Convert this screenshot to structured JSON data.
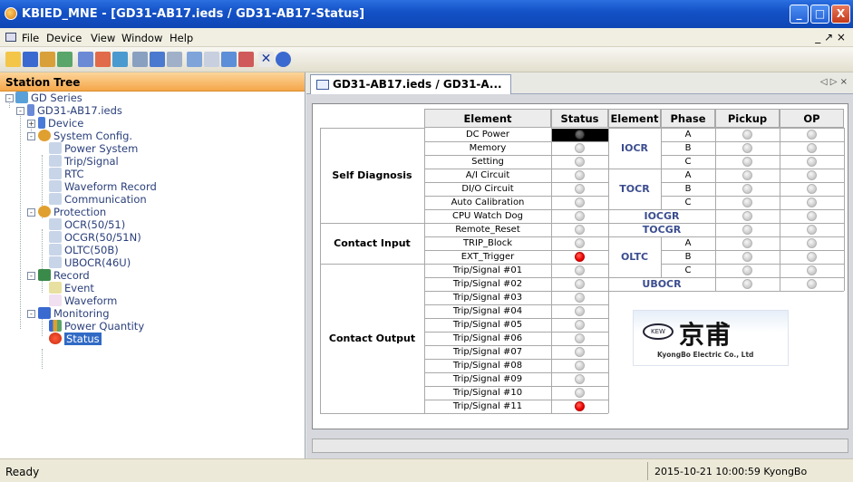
{
  "window": {
    "title": "KBIED_MNE - [GD31-AB17.ieds / GD31-AB17-Status]",
    "controls": {
      "minimize": "_",
      "maximize": "□",
      "close": "X"
    }
  },
  "menu": {
    "items": [
      "File",
      "Device",
      "View",
      "Window",
      "Help"
    ],
    "mdi_controls": "_ ↗ ×"
  },
  "toolbar": {
    "buttons": [
      "new-icon",
      "save-icon",
      "open-icon",
      "tree-icon",
      "list-icon",
      "upload-icon",
      "download-icon",
      "settings-icon",
      "monitor-icon",
      "table-icon",
      "window-icon",
      "chart-icon",
      "link-icon",
      "unlink-icon",
      "close-icon",
      "help-icon"
    ]
  },
  "sidebar": {
    "title": "Station Tree",
    "nodes": [
      {
        "label": "GD Series"
      },
      {
        "label": "GD31-AB17.ieds"
      },
      {
        "label": "Device"
      },
      {
        "label": "System Config."
      },
      {
        "label": "Power System"
      },
      {
        "label": "Trip/Signal"
      },
      {
        "label": "RTC"
      },
      {
        "label": "Waveform Record"
      },
      {
        "label": "Communication"
      },
      {
        "label": "Protection"
      },
      {
        "label": "OCR(50/51)"
      },
      {
        "label": "OCGR(50/51N)"
      },
      {
        "label": "OLTC(50B)"
      },
      {
        "label": "UBOCR(46U)"
      },
      {
        "label": "Record"
      },
      {
        "label": "Event"
      },
      {
        "label": "Waveform"
      },
      {
        "label": "Monitoring"
      },
      {
        "label": "Power Quantity"
      },
      {
        "label": "Status"
      }
    ]
  },
  "tab": {
    "label": "GD31-AB17.ieds / GD31-A...",
    "nav": "◁ ▷ ×"
  },
  "table": {
    "headers": {
      "element": "Element",
      "status": "Status",
      "element2": "Element",
      "phase": "Phase",
      "pickup": "Pickup",
      "op": "OP"
    },
    "groups": {
      "self_diagnosis": "Self Diagnosis",
      "contact_input": "Contact Input",
      "contact_output": "Contact Output"
    },
    "left_rows": [
      {
        "name": "DC Power",
        "state": "dark"
      },
      {
        "name": "Memory",
        "state": "off"
      },
      {
        "name": "Setting",
        "state": "off"
      },
      {
        "name": "A/I Circuit",
        "state": "off"
      },
      {
        "name": "DI/O Circuit",
        "state": "off"
      },
      {
        "name": "Auto Calibration",
        "state": "off"
      },
      {
        "name": "CPU Watch Dog",
        "state": "off"
      },
      {
        "name": "Remote_Reset",
        "state": "off"
      },
      {
        "name": "TRIP_Block",
        "state": "off"
      },
      {
        "name": "EXT_Trigger",
        "state": "red"
      },
      {
        "name": "Trip/Signal #01",
        "state": "off"
      },
      {
        "name": "Trip/Signal #02",
        "state": "off"
      },
      {
        "name": "Trip/Signal #03",
        "state": "off"
      },
      {
        "name": "Trip/Signal #04",
        "state": "off"
      },
      {
        "name": "Trip/Signal #05",
        "state": "off"
      },
      {
        "name": "Trip/Signal #06",
        "state": "off"
      },
      {
        "name": "Trip/Signal #07",
        "state": "off"
      },
      {
        "name": "Trip/Signal #08",
        "state": "off"
      },
      {
        "name": "Trip/Signal #09",
        "state": "off"
      },
      {
        "name": "Trip/Signal #10",
        "state": "off"
      },
      {
        "name": "Trip/Signal #11",
        "state": "red"
      }
    ],
    "right_groups": {
      "iocr": "IOCR",
      "tocr": "TOCR",
      "iocgr": "IOCGR",
      "tocgr": "TOCGR",
      "oltc": "OLTC",
      "ubocr": "UBOCR"
    },
    "phases": [
      "A",
      "B",
      "C",
      "A",
      "B",
      "C",
      "",
      "",
      "A",
      "B",
      "C",
      ""
    ]
  },
  "logo": {
    "mark": "KEW",
    "chinese": "京甫",
    "subtitle": "KyongBo Electric Co., Ltd"
  },
  "status": {
    "ready": "Ready",
    "timestamp": "2015-10-21 10:00:59  KyongBo"
  }
}
